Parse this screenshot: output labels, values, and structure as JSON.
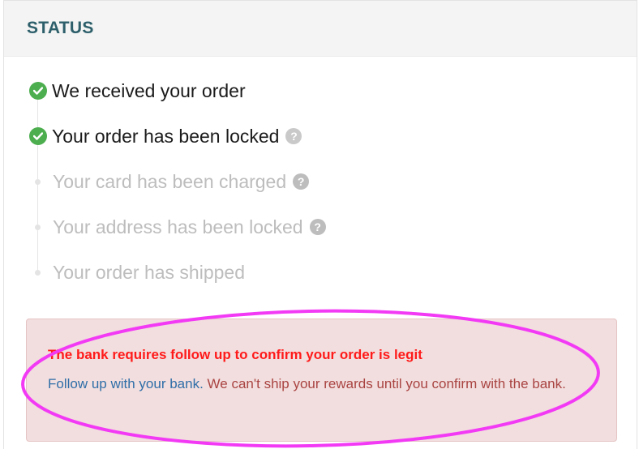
{
  "panel": {
    "title": "STATUS"
  },
  "steps": [
    {
      "label": "We received your order",
      "state": "done",
      "help": false
    },
    {
      "label": "Your order has been locked",
      "state": "done",
      "help": true
    },
    {
      "label": "Your card has been charged",
      "state": "pending",
      "help": true
    },
    {
      "label": "Your address has been locked",
      "state": "pending",
      "help": true
    },
    {
      "label": "Your order has shipped",
      "state": "pending",
      "help": false
    }
  ],
  "alert": {
    "title": "The bank requires follow up to confirm your order is legit",
    "link_text": "Follow up with your bank.",
    "message": " We can't ship your rewards until you confirm with the bank."
  },
  "colors": {
    "header_text": "#2d5f6b",
    "check_green": "#4cae4f",
    "alert_bg": "#f2dede",
    "alert_title": "#ff1a1a",
    "alert_text": "#a94442",
    "link": "#2f6ea8",
    "annotation": "#f23af5"
  },
  "icons": {
    "done": "check-circle-icon",
    "pending": "timeline-dot-icon",
    "help": "question-circle-icon"
  }
}
